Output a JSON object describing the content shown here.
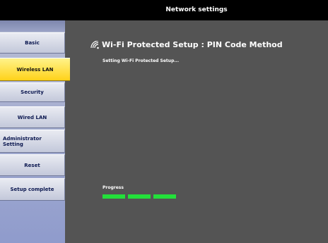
{
  "window": {
    "title": "Network settings"
  },
  "sidebar": {
    "items": [
      {
        "label": "Basic",
        "active": false
      },
      {
        "label": "Wireless LAN",
        "active": true
      },
      {
        "label": "Security",
        "active": false
      },
      {
        "label": "Wired LAN",
        "active": false
      },
      {
        "label": "Administrator Setting",
        "active": false
      },
      {
        "label": "Reset",
        "active": false
      },
      {
        "label": "Setup complete",
        "active": false
      }
    ]
  },
  "main": {
    "title": "Wi-Fi Protected Setup : PIN Code Method",
    "status": "Setting Wi-Fi Protected Setup...",
    "icon": "wifi-signal-icon",
    "progress": {
      "label": "Progress",
      "segments_filled": 3,
      "color": "#23e03a"
    }
  },
  "colors": {
    "active_item": "#ffd21a",
    "content_bg": "#545454",
    "title_bg": "#000000"
  }
}
